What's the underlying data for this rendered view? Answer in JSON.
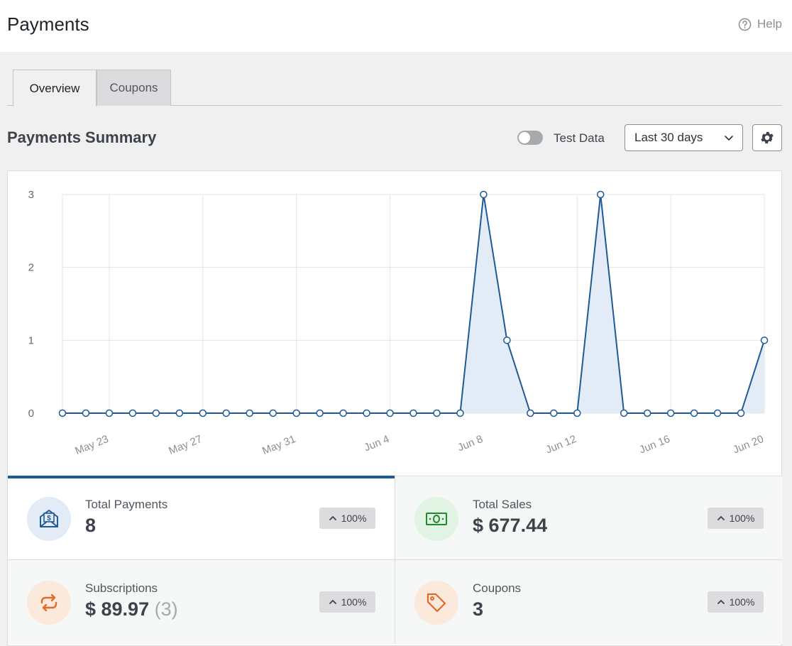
{
  "header": {
    "title": "Payments",
    "help_label": "Help"
  },
  "tabs": [
    {
      "label": "Overview",
      "active": true
    },
    {
      "label": "Coupons",
      "active": false
    }
  ],
  "summary": {
    "title": "Payments Summary",
    "test_data_label": "Test Data",
    "test_data_enabled": false,
    "range_value": "Last 30 days"
  },
  "chart_data": {
    "type": "area",
    "title": "",
    "xlabel": "",
    "ylabel": "",
    "x": [
      "May 21",
      "May 22",
      "May 23",
      "May 24",
      "May 25",
      "May 26",
      "May 27",
      "May 28",
      "May 29",
      "May 30",
      "May 31",
      "Jun 1",
      "Jun 2",
      "Jun 3",
      "Jun 4",
      "Jun 5",
      "Jun 6",
      "Jun 7",
      "Jun 8",
      "Jun 9",
      "Jun 10",
      "Jun 11",
      "Jun 12",
      "Jun 13",
      "Jun 14",
      "Jun 15",
      "Jun 16",
      "Jun 17",
      "Jun 18",
      "Jun 19",
      "Jun 20"
    ],
    "values": [
      0,
      0,
      0,
      0,
      0,
      0,
      0,
      0,
      0,
      0,
      0,
      0,
      0,
      0,
      0,
      0,
      0,
      0,
      3,
      1,
      0,
      0,
      0,
      3,
      0,
      0,
      0,
      0,
      0,
      0,
      1
    ],
    "tick_labels": [
      "May 23",
      "May 27",
      "May 31",
      "Jun 4",
      "Jun 8",
      "Jun 12",
      "Jun 16",
      "Jun 20"
    ],
    "y_ticks": [
      0,
      1,
      2,
      3
    ],
    "ylim": [
      0,
      3
    ],
    "grid": true,
    "line_color": "#1e5a96",
    "fill_color": "#e3ebf6"
  },
  "stats": [
    {
      "label": "Total Payments",
      "value": "8",
      "change": "100%",
      "icon": "envelope-dollar-icon",
      "color": "#1e5a96",
      "bg": "#e3ebf6",
      "active": true
    },
    {
      "label": "Total Sales",
      "value": "$ 677.44",
      "change": "100%",
      "icon": "banknote-icon",
      "color": "#1f8a2e",
      "bg": "#e1f3e3",
      "active": false
    },
    {
      "label": "Subscriptions",
      "value": "$ 89.97",
      "value_sub": "(3)",
      "change": "100%",
      "icon": "repeat-icon",
      "color": "#e06b26",
      "bg": "#fbe9dc",
      "active": false
    },
    {
      "label": "Coupons",
      "value": "3",
      "change": "100%",
      "icon": "tag-icon",
      "color": "#e06b26",
      "bg": "#fbe9dc",
      "active": false
    }
  ]
}
